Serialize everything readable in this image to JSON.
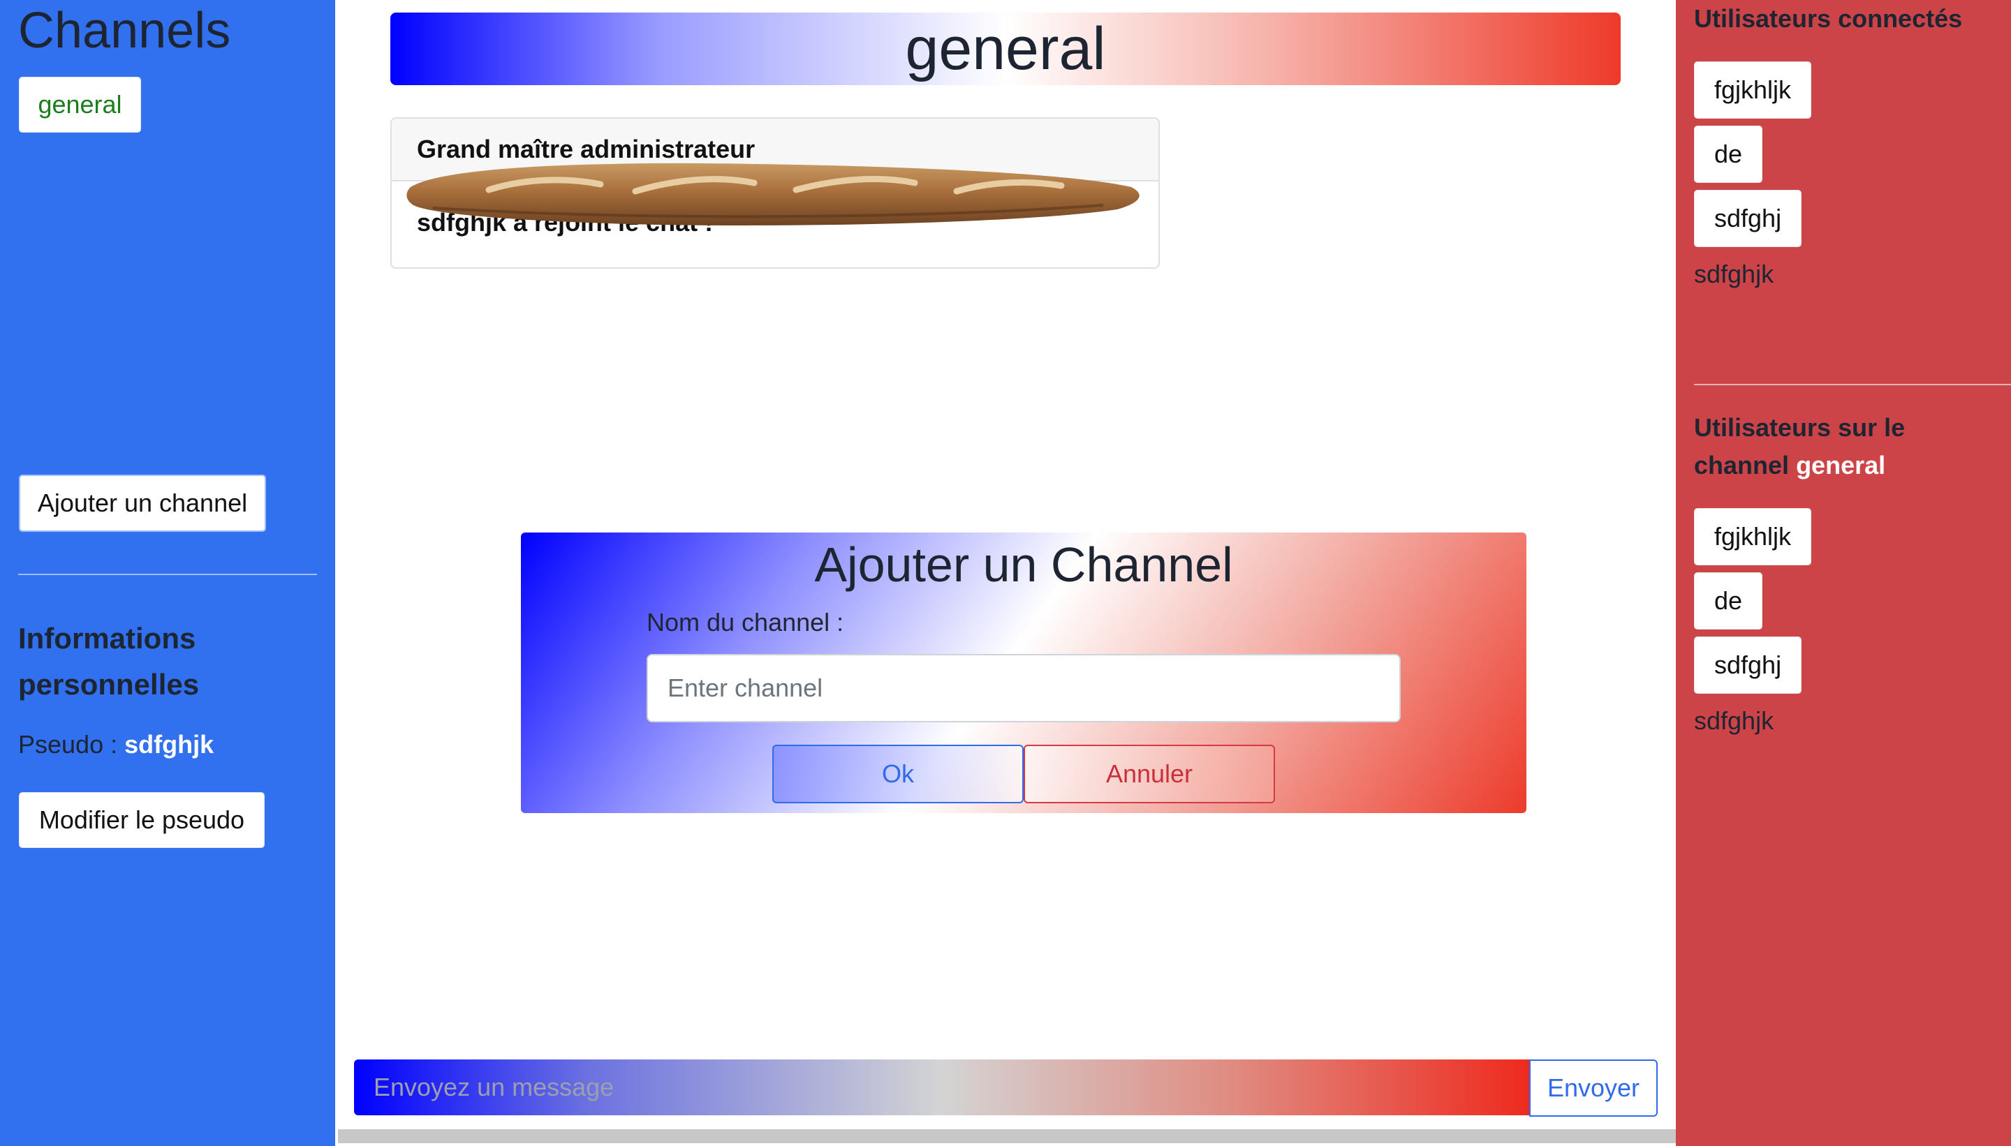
{
  "left": {
    "title": "Channels",
    "channels": [
      {
        "label": "general",
        "color": "#1b7d1b"
      }
    ],
    "add_channel_label": "Ajouter un channel",
    "info_title": "Informations personnelles",
    "pseudo_label": "Pseudo :",
    "pseudo_value": "sdfghjk",
    "modify_pseudo_label": "Modifier le pseudo"
  },
  "center": {
    "channel_title": "general",
    "messages": [
      {
        "author": "Grand maître administrateur",
        "text": "sdfghjk a rejoint le chat !"
      }
    ],
    "message_placeholder": "Envoyez un message",
    "send_label": "Envoyer"
  },
  "modal": {
    "title": "Ajouter un Channel",
    "label": "Nom du channel :",
    "placeholder": "Enter channel",
    "ok_label": "Ok",
    "cancel_label": "Annuler"
  },
  "right": {
    "connected_title": "Utilisateurs connectés",
    "connected_users": [
      "fgjkhljk",
      "de",
      "sdfghj"
    ],
    "current_user": "sdfghjk",
    "channel_users_title": "Utilisateurs sur le channel",
    "channel_name": "general",
    "channel_users": [
      "fgjkhljk",
      "de",
      "sdfghj"
    ],
    "channel_current_user": "sdfghjk"
  },
  "colors": {
    "left_bg": "#3170ee",
    "right_bg": "#cc4448",
    "primary": "#2f6bea",
    "danger": "#c8303c"
  }
}
